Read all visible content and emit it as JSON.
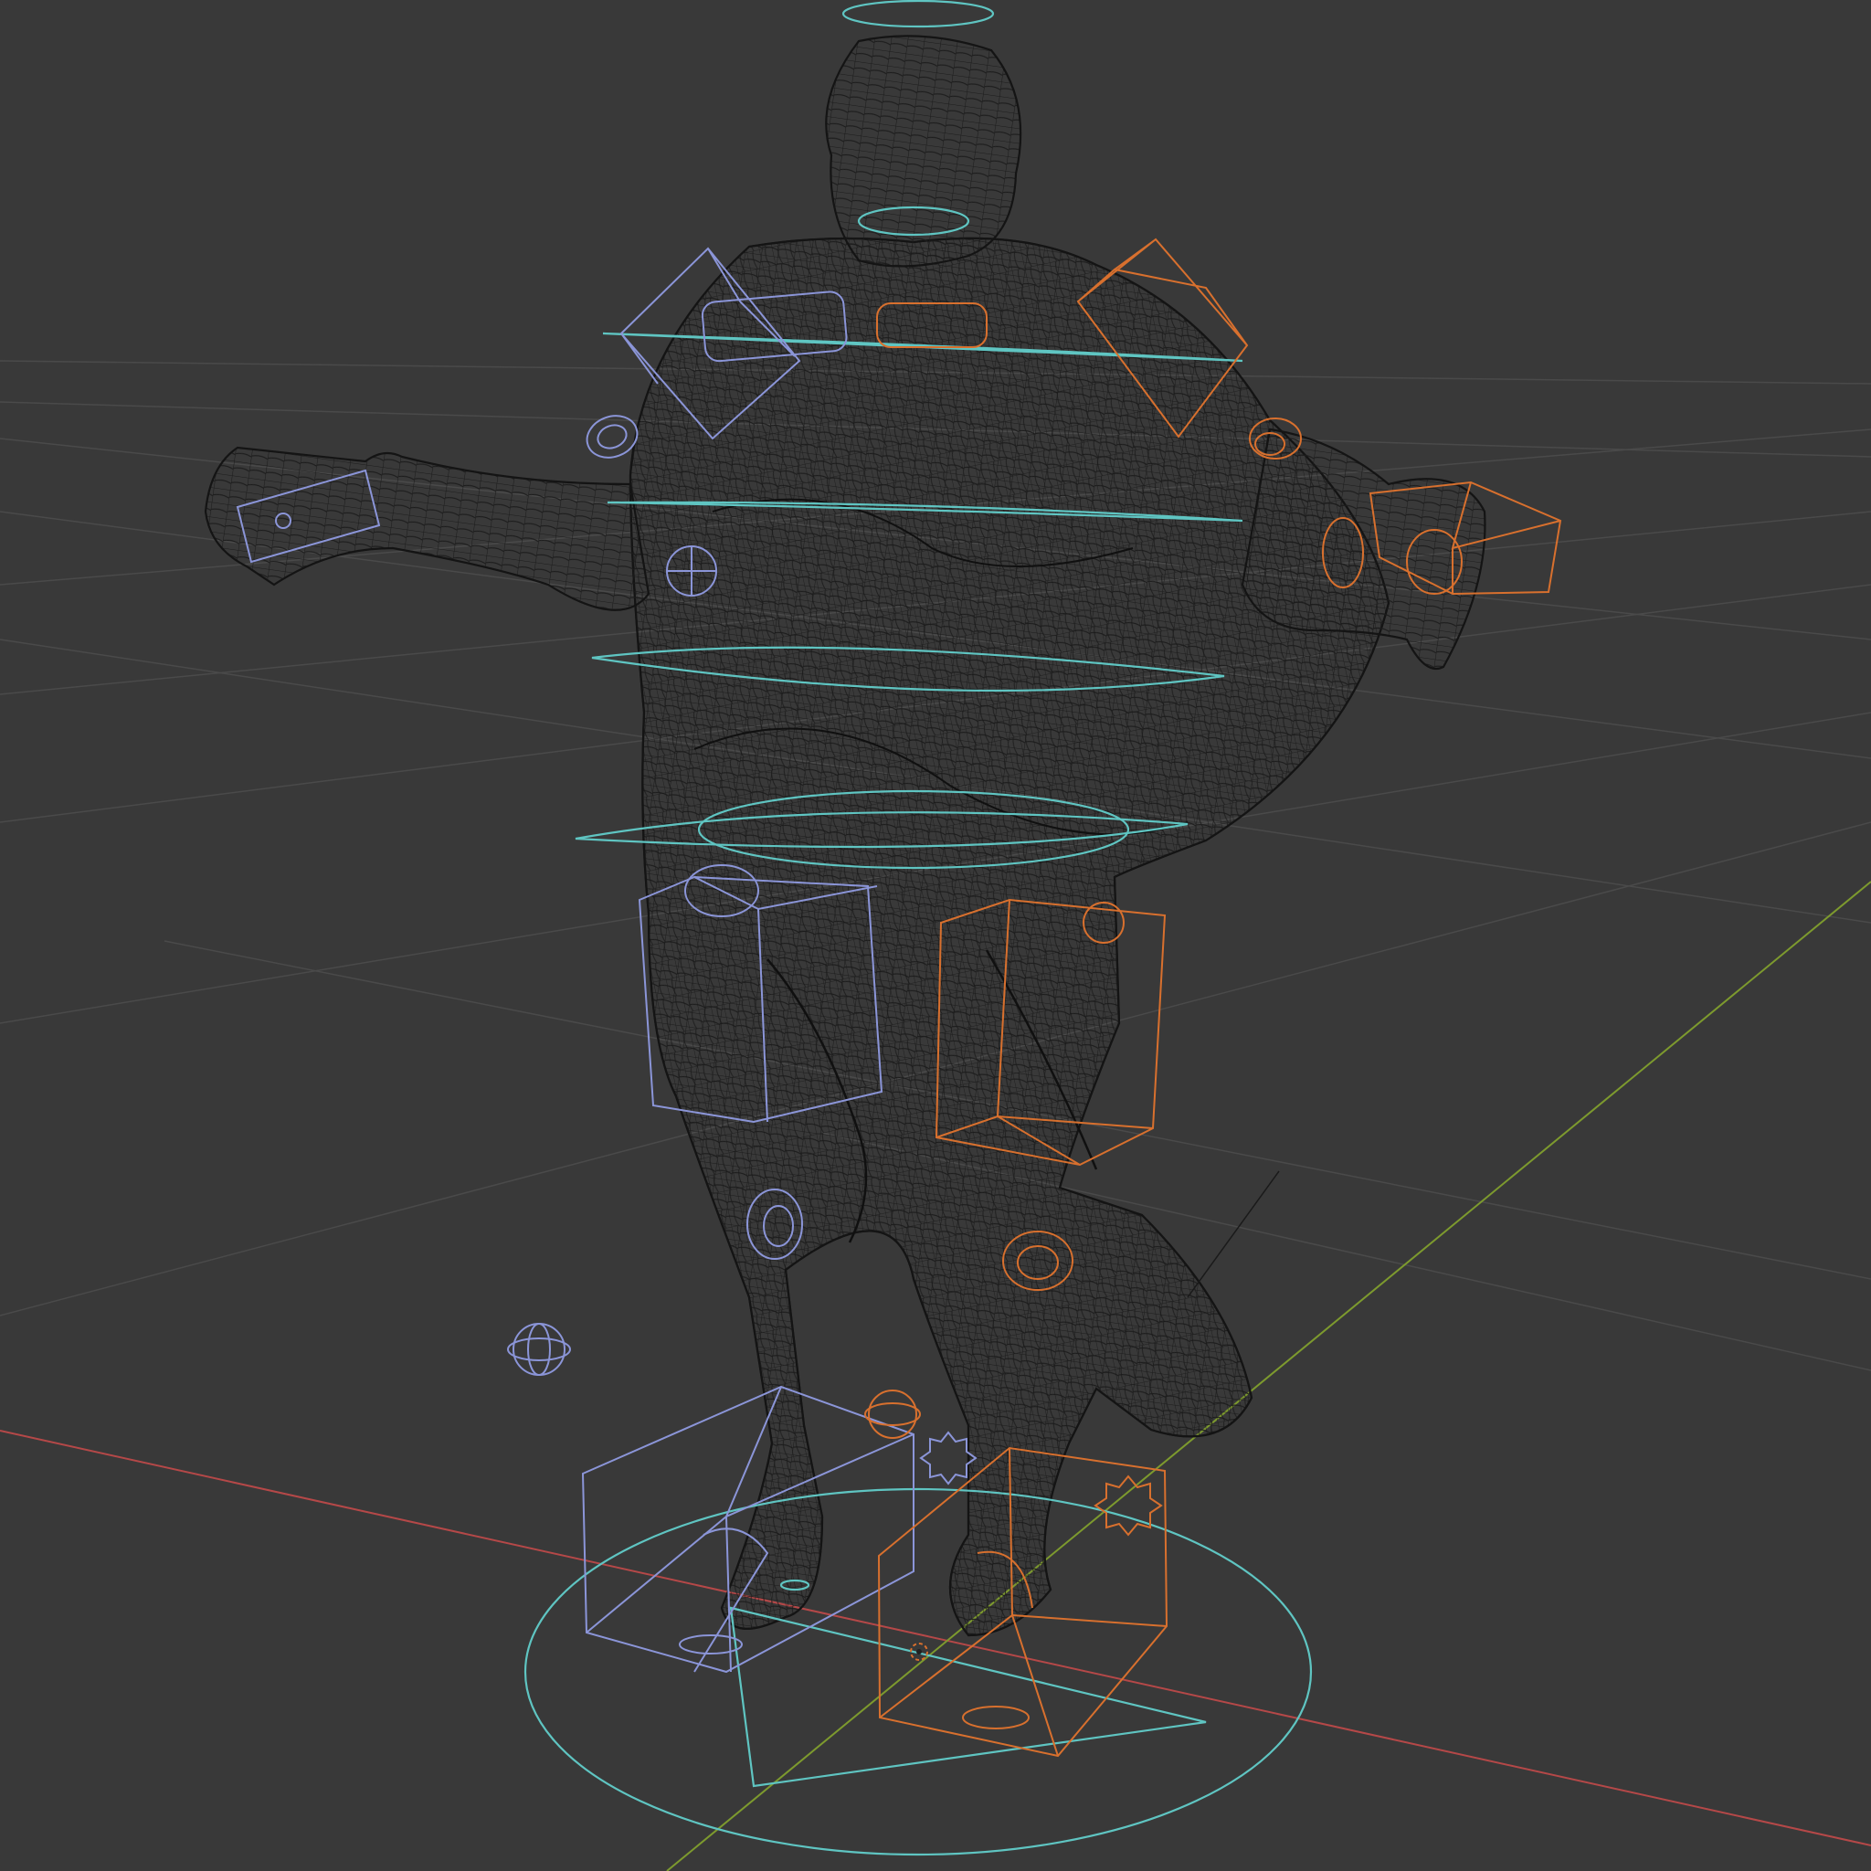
{
  "viewport": {
    "background": "#393939",
    "mode": "wireframe",
    "view": "perspective"
  },
  "colors": {
    "grid": "#4a4a4a",
    "axis_x": "#b54848",
    "axis_y": "#7d9a2e",
    "mesh": "#151515",
    "controls_left": "#8b95d8",
    "controls_right": "#d8702e",
    "controls_center": "#5fc5c2"
  },
  "scene": {
    "object": "character-mesh",
    "rig": "control-rig",
    "cursor": "3d-cursor"
  }
}
